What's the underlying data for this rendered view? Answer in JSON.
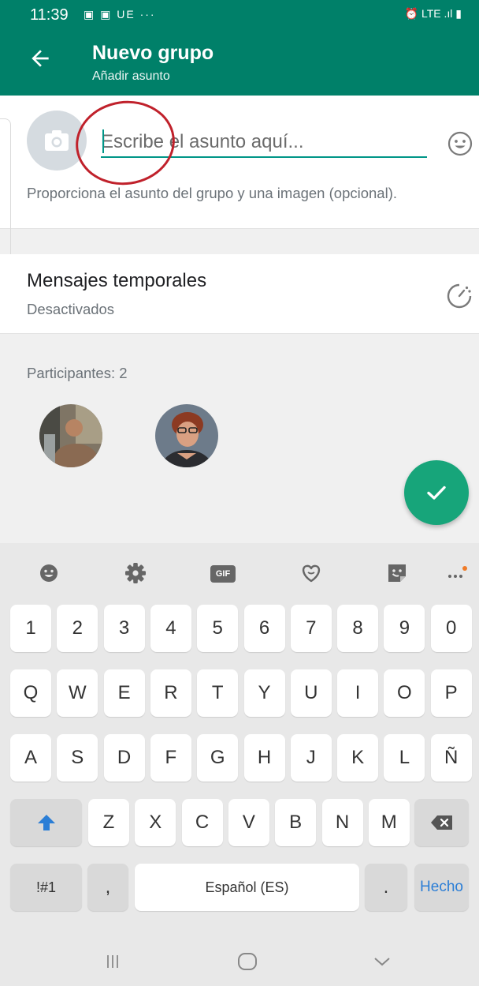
{
  "status_bar": {
    "time": "11:39",
    "left_icons": "▣ ▣ UE ···",
    "right_icons": "⏰ LTE .ıl ▮"
  },
  "header": {
    "title": "Nuevo grupo",
    "subtitle": "Añadir asunto"
  },
  "subject": {
    "placeholder": "Escribe el asunto aquí...",
    "hint": "Proporciona el asunto del grupo y una imagen (opcional)."
  },
  "temporary_messages": {
    "title": "Mensajes temporales",
    "status": "Desactivados"
  },
  "participants": {
    "label": "Participantes: 2"
  },
  "keyboard": {
    "number_row": [
      "1",
      "2",
      "3",
      "4",
      "5",
      "6",
      "7",
      "8",
      "9",
      "0"
    ],
    "row1": [
      "Q",
      "W",
      "E",
      "R",
      "T",
      "Y",
      "U",
      "I",
      "O",
      "P"
    ],
    "row2": [
      "A",
      "S",
      "D",
      "F",
      "G",
      "H",
      "J",
      "K",
      "L",
      "Ñ"
    ],
    "row3": [
      "Z",
      "X",
      "C",
      "V",
      "B",
      "N",
      "M"
    ],
    "symbols": "!#1",
    "comma": ",",
    "space": "Español (ES)",
    "period": ".",
    "done": "Hecho",
    "gif": "GIF"
  },
  "colors": {
    "header": "#008069",
    "accent": "#009688",
    "fab": "#17a57a",
    "annotation": "#c0212b",
    "done_text": "#2b7ed6"
  }
}
